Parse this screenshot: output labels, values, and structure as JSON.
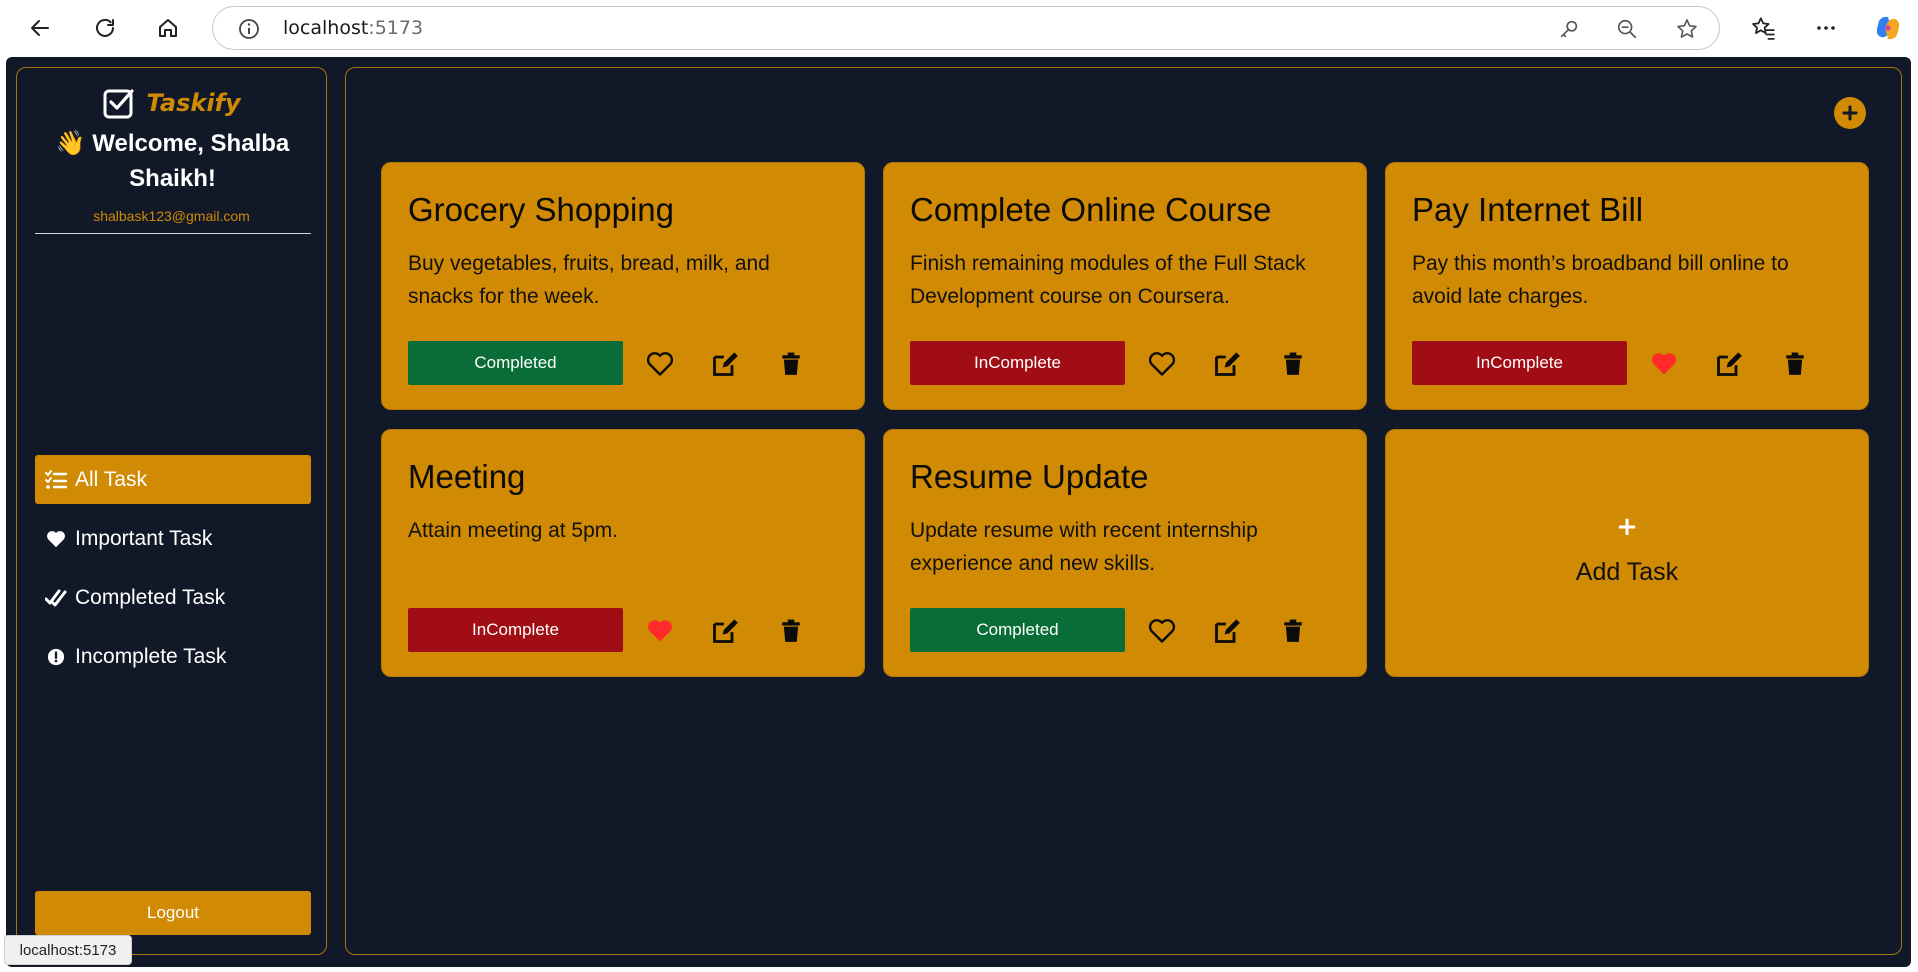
{
  "browser": {
    "url_host": "localhost",
    "url_port": ":5173",
    "status_url": "localhost:5173"
  },
  "app": {
    "brand": "Taskify",
    "welcome_line": "👋 Welcome, Shalba Shaikh!",
    "email": "shalbask123@gmail.com",
    "nav": [
      {
        "label": "All Task",
        "icon": "list-check-icon",
        "active": true
      },
      {
        "label": "Important Task",
        "icon": "heart-icon",
        "active": false
      },
      {
        "label": "Completed Task",
        "icon": "double-check-icon",
        "active": false
      },
      {
        "label": "Incomplete Task",
        "icon": "exclamation-circle-icon",
        "active": false
      }
    ],
    "logout_label": "Logout"
  },
  "tasks": [
    {
      "title": "Grocery Shopping",
      "description": "Buy vegetables, fruits, bread, milk, and snacks for the week.",
      "status": "Completed",
      "important": false
    },
    {
      "title": "Complete Online Course",
      "description": "Finish remaining modules of the Full Stack Development course on Coursera.",
      "status": "InComplete",
      "important": false
    },
    {
      "title": "Pay Internet Bill",
      "description": "Pay this month’s broadband bill online to avoid late charges.",
      "status": "InComplete",
      "important": true
    },
    {
      "title": "Meeting",
      "description": "Attain meeting at 5pm.",
      "status": "InComplete",
      "important": true
    },
    {
      "title": "Resume Update",
      "description": "Update resume with recent internship experience and new skills.",
      "status": "Completed",
      "important": false
    }
  ],
  "add_card": {
    "plus": "+",
    "label": "Add Task"
  },
  "colors": {
    "accent": "#d08a04",
    "background": "#111827",
    "completed": "#0a6d37",
    "incomplete": "#a00d14",
    "heart_active": "#ff2a2a"
  }
}
